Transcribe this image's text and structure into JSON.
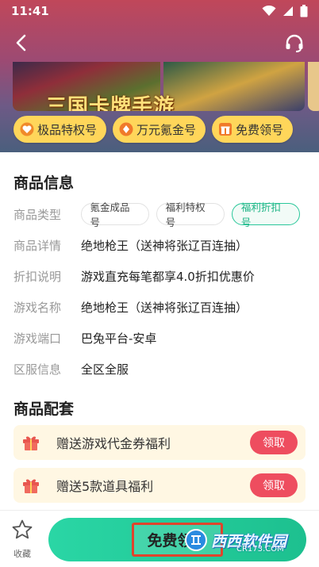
{
  "status_bar": {
    "time": "11:41"
  },
  "banner": {
    "title_text": "三国卡牌手游"
  },
  "tags": [
    {
      "label": "极品特权号",
      "icon": "heart-shield-icon"
    },
    {
      "label": "万元氪金号",
      "icon": "diamond-coin-icon"
    },
    {
      "label": "免费领号",
      "icon": "gift-icon"
    }
  ],
  "product_info": {
    "title": "商品信息",
    "type_label": "商品类型",
    "type_options": [
      "氪金成品号",
      "福利特权号",
      "福利折扣号"
    ],
    "type_selected": "福利折扣号",
    "detail_label": "商品详情",
    "detail_value": "绝地枪王（送神将张辽百连抽）",
    "discount_label": "折扣说明",
    "discount_value": "游戏直充每笔都享4.0折扣优惠价",
    "game_name_label": "游戏名称",
    "game_name_value": "绝地枪王（送神将张辽百连抽）",
    "platform_label": "游戏端口",
    "platform_value": "巴兔平台-安卓",
    "server_label": "区服信息",
    "server_value": "全区全服"
  },
  "bundle": {
    "title": "商品配套",
    "items": [
      {
        "text": "赠送游戏代金券福利",
        "button": "领取"
      },
      {
        "text": "赠送5款道具福利",
        "button": "领取"
      }
    ]
  },
  "bottom_bar": {
    "favorite_label": "收藏",
    "free_button_label": "免费领号"
  },
  "watermark": {
    "text": "西西软件园",
    "sub": "CR173.COM"
  },
  "colors": {
    "accent_green": "#29c79a",
    "tag_yellow": "#ffd65a",
    "claim_red": "#ee4d5f",
    "bonus_bg": "#fff7e3"
  }
}
